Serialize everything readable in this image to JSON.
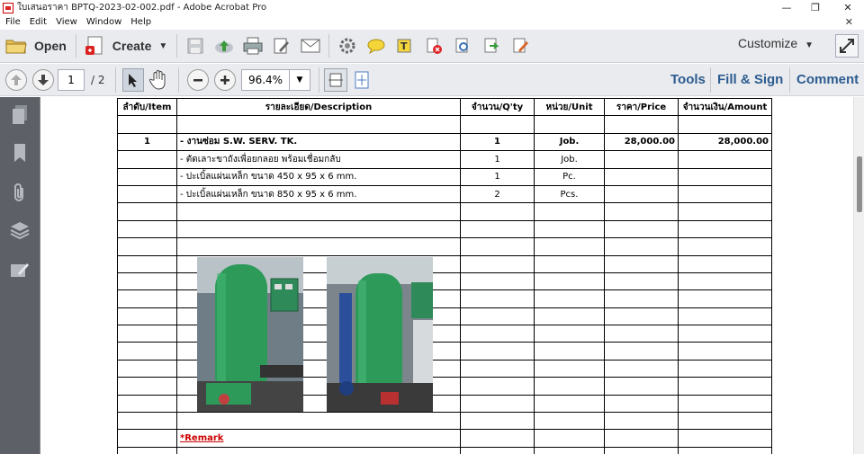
{
  "window": {
    "title": "ใบเสนอราคา BPTQ-2023-02-002.pdf - Adobe Acrobat Pro",
    "minimize": "—",
    "restore": "❐",
    "close": "✕"
  },
  "menu": {
    "items": [
      "File",
      "Edit",
      "View",
      "Window",
      "Help"
    ],
    "close_doc": "✕"
  },
  "toolbar": {
    "open_label": "Open",
    "create_label": "Create",
    "create_caret": "▼",
    "customize_label": "Customize",
    "customize_caret": "▼"
  },
  "nav": {
    "current_page": "1",
    "total_pages": "/ 2",
    "zoom": "96.4%",
    "zoom_caret": "▼",
    "links": [
      "Tools",
      "Fill & Sign",
      "Comment"
    ]
  },
  "quote_table": {
    "headers": [
      "ลำดับ/Item",
      "รายละเอียด/Description",
      "จำนวน/Q'ty",
      "หน่วย/Unit",
      "ราคา/Price",
      "จำนวนเงิน/Amount"
    ],
    "rows": [
      {
        "item": "1",
        "desc": "- งานซ่อม S.W. SERV. TK.",
        "qty": "1",
        "unit": "Job.",
        "price": "28,000.00",
        "amount": "28,000.00"
      },
      {
        "item": "",
        "desc": "- ตัดเลาะขาถังเพื่อยกลอย พร้อมเชื่อมกลับ",
        "qty": "1",
        "unit": "Job.",
        "price": "",
        "amount": ""
      },
      {
        "item": "",
        "desc": "- ปะเบิ้ลแผ่นเหล็ก ขนาด 450 x 95 x 6 mm.",
        "qty": "1",
        "unit": "Pc.",
        "price": "",
        "amount": ""
      },
      {
        "item": "",
        "desc": "- ปะเบิ้ลแผ่นเหล็ก ขนาด 850 x 95 x 6 mm.",
        "qty": "2",
        "unit": "Pcs.",
        "price": "",
        "amount": ""
      }
    ],
    "remark": "*Remark"
  },
  "colors": {
    "accent_link": "#2d5c8f",
    "remark": "#cc0000",
    "tank_green": "#2e9a5a"
  }
}
